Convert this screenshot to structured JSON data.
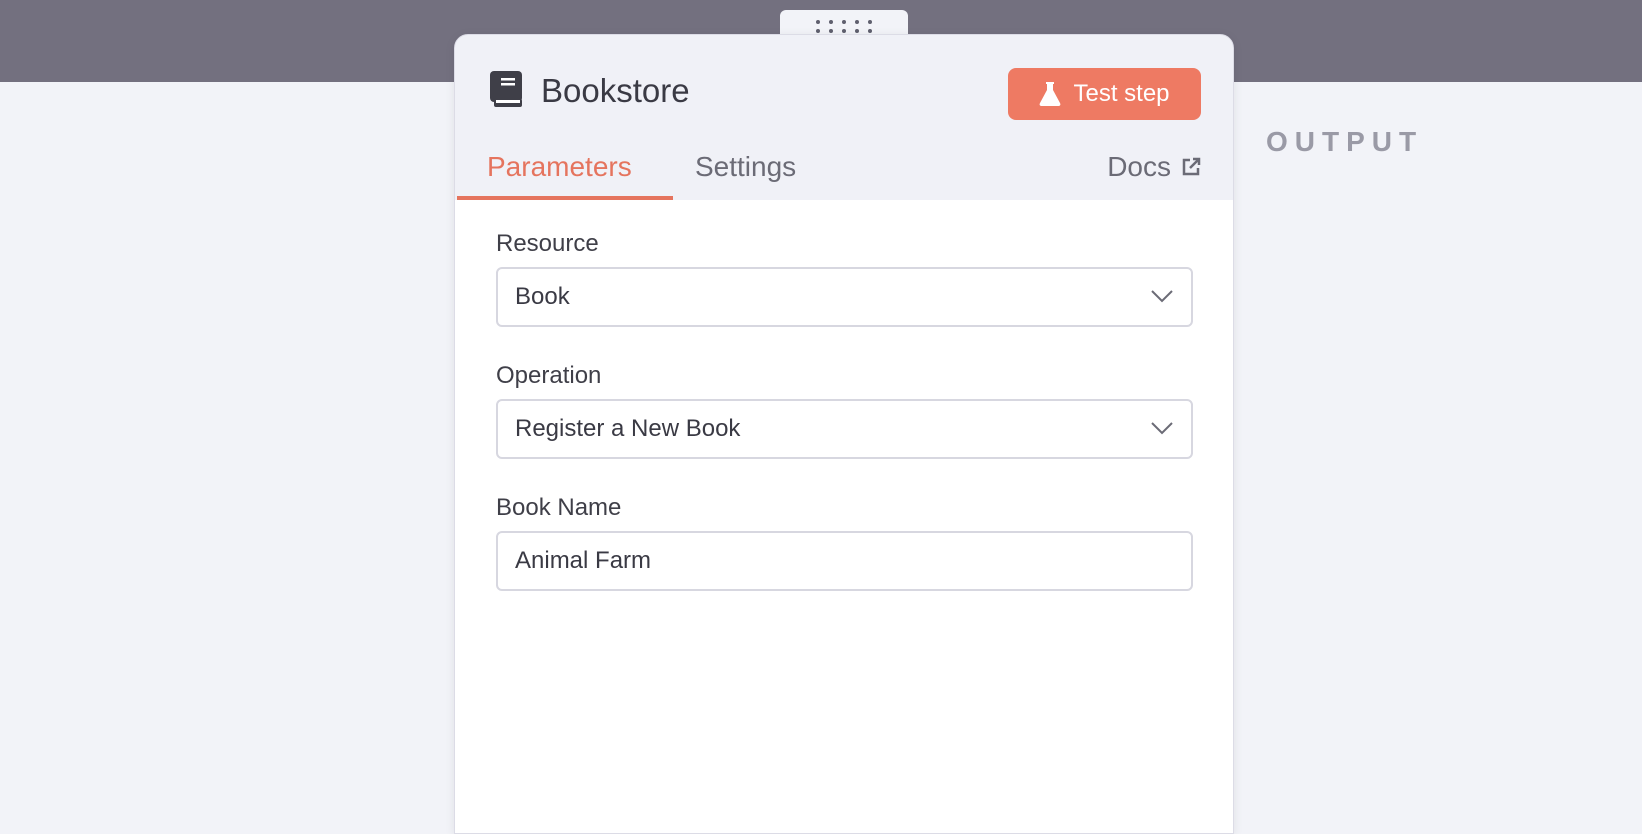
{
  "output_panel": {
    "label": "OUTPUT"
  },
  "node": {
    "title": "Bookstore",
    "icon": "book-icon",
    "test_button_label": "Test step",
    "test_button_icon": "flask-icon"
  },
  "tabs": {
    "items": [
      {
        "label": "Parameters",
        "active": true
      },
      {
        "label": "Settings",
        "active": false
      }
    ],
    "docs_label": "Docs",
    "docs_icon": "external-link-icon"
  },
  "fields": {
    "resource": {
      "label": "Resource",
      "value": "Book",
      "type": "select"
    },
    "operation": {
      "label": "Operation",
      "value": "Register a New Book",
      "type": "select"
    },
    "book_name": {
      "label": "Book Name",
      "value": "Animal Farm",
      "type": "text"
    }
  },
  "colors": {
    "accent": "#e5745e",
    "button": "#ee7a63",
    "top_band": "#73707f",
    "background": "#f2f3f8"
  }
}
